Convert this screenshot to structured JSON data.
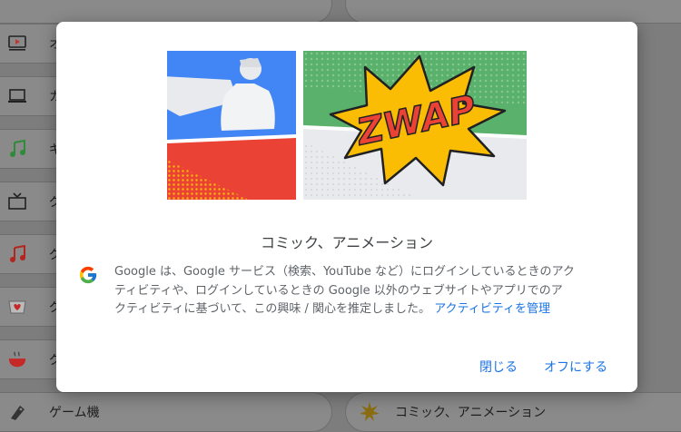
{
  "background_list": {
    "left_items": [
      {
        "label": "オ",
        "icon": "video-player-icon"
      },
      {
        "label": "カ",
        "icon": "laptop-icon"
      },
      {
        "label": "ギ",
        "icon": "music-note-icon"
      },
      {
        "label": "グ",
        "icon": "tv-icon"
      },
      {
        "label": "グ",
        "icon": "music-note-icon"
      },
      {
        "label": "グ",
        "icon": "heart-card-icon"
      },
      {
        "label": "グ",
        "icon": "bowl-icon"
      },
      {
        "label": "ゲーム機",
        "icon": "gamepad-icon"
      }
    ],
    "right_item_bottom": {
      "label": "コミック、アニメーション",
      "icon": "starburst-icon"
    }
  },
  "dialog": {
    "illustration_text": "ZWAP",
    "title": "コミック、アニメーション",
    "description_lines": [
      "Google は、Google サービス（検索、YouTube など）にログインしているときのアク",
      "ティビティや、ログインしているときの Google 以外のウェブサイトやアプリでのア",
      "クティビティに基づいて、この興味 / 関心を推定しました。"
    ],
    "activity_link": "アクティビティを管理",
    "close_button": "閉じる",
    "turn_off_button": "オフにする"
  },
  "colors": {
    "link_blue": "#1a73e8",
    "panel_blue": "#4285f4",
    "panel_red": "#ea4335",
    "panel_green": "#5ab16b",
    "burst_yellow": "#fbbc04"
  }
}
